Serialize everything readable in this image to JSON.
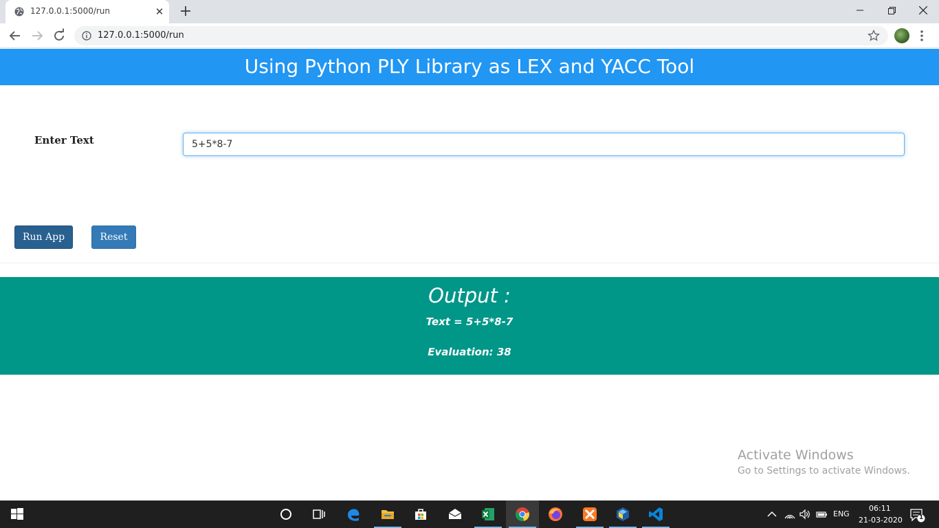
{
  "browser": {
    "tab_title": "127.0.0.1:5000/run",
    "url": "127.0.0.1:5000/run",
    "new_tab": "+",
    "close_tab": "✕"
  },
  "page": {
    "banner_title": "Using Python PLY Library as LEX and YACC Tool",
    "input_label": "Enter Text",
    "input_value": "5+5*8-7",
    "run_button": "Run App",
    "reset_button": "Reset",
    "output_heading": "Output :",
    "output_text": "Text = 5+5*8-7",
    "output_evaluation": "Evaluation: 38"
  },
  "watermark": {
    "line1": "Activate Windows",
    "line2": "Go to Settings to activate Windows."
  },
  "taskbar": {
    "language": "ENG",
    "time": "06:11",
    "date": "21-03-2020",
    "notification_count": "1"
  },
  "colors": {
    "banner": "#2196f3",
    "output_panel": "#009688",
    "run_button": "#286090",
    "reset_button": "#337ab7"
  }
}
